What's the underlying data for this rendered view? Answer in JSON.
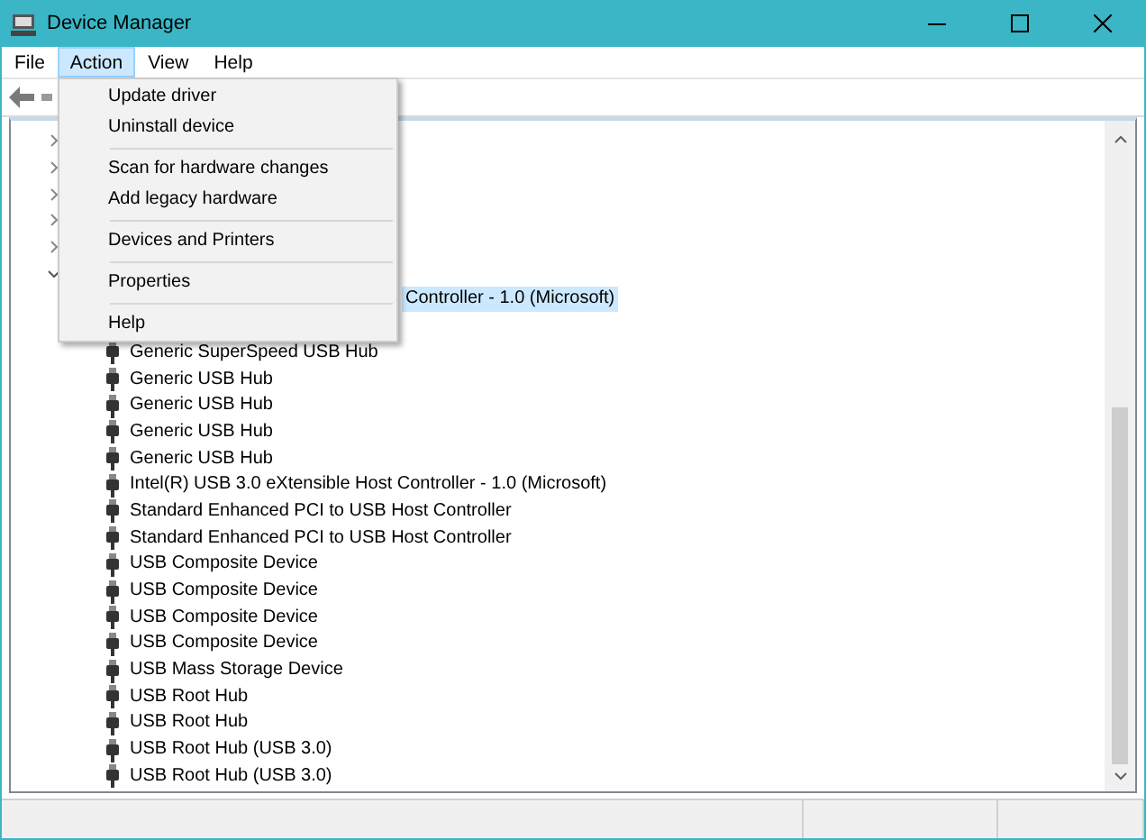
{
  "window": {
    "title": "Device Manager"
  },
  "menu_bar": [
    {
      "label": "File",
      "selected": false
    },
    {
      "label": "Action",
      "selected": true
    },
    {
      "label": "View",
      "selected": false
    },
    {
      "label": "Help",
      "selected": false
    }
  ],
  "action_menu": [
    {
      "kind": "item",
      "label": "Update driver"
    },
    {
      "kind": "item",
      "label": "Uninstall device"
    },
    {
      "kind": "separator"
    },
    {
      "kind": "item",
      "label": "Scan for hardware changes"
    },
    {
      "kind": "item",
      "label": "Add legacy hardware"
    },
    {
      "kind": "separator"
    },
    {
      "kind": "item",
      "label": "Devices and Printers"
    },
    {
      "kind": "separator"
    },
    {
      "kind": "item",
      "label": "Properties"
    },
    {
      "kind": "separator"
    },
    {
      "kind": "item",
      "label": "Help"
    }
  ],
  "tree": [
    {
      "expanded": false
    },
    {
      "expanded": false
    },
    {
      "expanded": false
    },
    {
      "expanded": false
    },
    {
      "expanded": false
    },
    {
      "expanded": true,
      "children": [
        {
          "label": "Controller - 1.0 (Microsoft)",
          "selected": true
        },
        {
          "label": "Generic SuperSpeed USB Hub",
          "selected": false
        },
        {
          "label": "Generic USB Hub",
          "selected": false
        },
        {
          "label": "Generic USB Hub",
          "selected": false
        },
        {
          "label": "Generic USB Hub",
          "selected": false
        },
        {
          "label": "Generic USB Hub",
          "selected": false
        },
        {
          "label": "Intel(R) USB 3.0 eXtensible Host Controller - 1.0 (Microsoft)",
          "selected": false
        },
        {
          "label": "Standard Enhanced PCI to USB Host Controller",
          "selected": false
        },
        {
          "label": "Standard Enhanced PCI to USB Host Controller",
          "selected": false
        },
        {
          "label": "USB Composite Device",
          "selected": false
        },
        {
          "label": "USB Composite Device",
          "selected": false
        },
        {
          "label": "USB Composite Device",
          "selected": false
        },
        {
          "label": "USB Composite Device",
          "selected": false
        },
        {
          "label": "USB Mass Storage Device",
          "selected": false
        },
        {
          "label": "USB Root Hub",
          "selected": false
        },
        {
          "label": "USB Root Hub",
          "selected": false
        },
        {
          "label": "USB Root Hub (USB 3.0)",
          "selected": false
        },
        {
          "label": "USB Root Hub (USB 3.0)",
          "selected": false
        }
      ]
    }
  ]
}
